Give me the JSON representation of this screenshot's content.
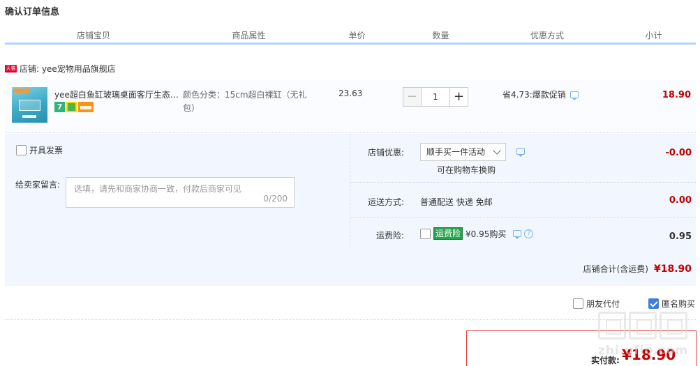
{
  "page": {
    "title": "确认订单信息"
  },
  "columns": [
    "店铺宝贝",
    "商品属性",
    "单价",
    "数量",
    "优惠方式",
    "小计"
  ],
  "shop": {
    "badge": "天猫",
    "label": "店铺: yee宠物用品旗舰店"
  },
  "item": {
    "name": "yee超白鱼缸玻璃桌面客厅生态鱼缸",
    "svc_seven": "7",
    "attr": "颜色分类：15cm超白裸缸（无礼包）",
    "price": "23.63",
    "qty_minus": "−",
    "qty": "1",
    "qty_plus": "+",
    "promo": "省4.73:爆款促销",
    "subtotal": "18.90"
  },
  "options": {
    "invoice_label": "开具发票",
    "memo_label": "给卖家留言:",
    "memo_placeholder": "选填，请先和商家协商一致，付款后商家可见",
    "memo_count": "0/200",
    "shop_discount_label": "店铺优惠:",
    "shop_discount_value": "顺手买一件活动",
    "shop_discount_note": "可在购物车换购",
    "shop_discount_amount": "-0.00",
    "shipping_label": "运送方式:",
    "shipping_value": "普通配送 快递 免邮",
    "shipping_amount": "0.00",
    "insurance_label": "运费险:",
    "insurance_badge": "运费险",
    "insurance_price": "¥0.95购买",
    "insurance_help": "?",
    "insurance_amount": "0.95"
  },
  "shop_total": {
    "label": "店铺合计(含运费)",
    "amount": "¥18.90"
  },
  "final": {
    "friend_pay": "朋友代付",
    "anonymous": "匿名购买",
    "anonymous_checked": true,
    "pay_label": "实付款:",
    "pay_amount": "¥18.90"
  },
  "watermark": {
    "url": "zhi.ufio.com"
  },
  "colors": {
    "price_red": "#c40000",
    "header_line": "#b2d1ff",
    "panel_bg": "#f2f7ff",
    "insurance_green": "#27a34c",
    "check_blue": "#3f7de0"
  }
}
